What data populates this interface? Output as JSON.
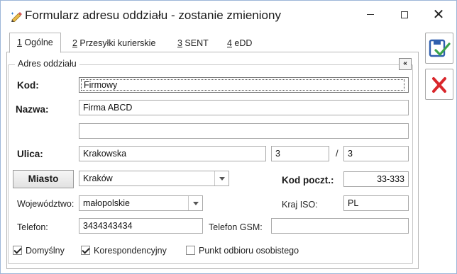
{
  "window": {
    "title": "Formularz adresu oddziału - zostanie zmieniony",
    "minimize_icon": "minimize-icon",
    "maximize_icon": "maximize-icon",
    "close_label": "✕"
  },
  "tabs": [
    {
      "key": "1",
      "label": " Ogólne",
      "active": true
    },
    {
      "key": "2",
      "label": " Przesyłki kurierskie",
      "active": false
    },
    {
      "key": "3",
      "label": " SENT",
      "active": false
    },
    {
      "key": "4",
      "label": " eDD",
      "active": false
    }
  ],
  "group": {
    "title": "Adres oddziału",
    "collapse_label": "«"
  },
  "form": {
    "kod_label": "Kod:",
    "kod_value": "Firmowy",
    "nazwa_label": "Nazwa:",
    "nazwa_value": "Firma ABCD",
    "nazwa2_value": "",
    "ulica_label": "Ulica:",
    "ulica_value": "Krakowska",
    "nr_domu": "3",
    "slash": "/",
    "nr_lokalu": "3",
    "miasto_button": "Miasto",
    "miasto_value": "Kraków",
    "kod_poczt_label": "Kod poczt.:",
    "kod_poczt_value": "33-333",
    "wojewodztwo_label": "Województwo:",
    "wojewodztwo_value": "małopolskie",
    "kraj_iso_label": "Kraj ISO:",
    "kraj_iso_value": "PL",
    "telefon_label": "Telefon:",
    "telefon_value": "3434343434",
    "telefon_gsm_label": "Telefon GSM:",
    "telefon_gsm_value": ""
  },
  "checkboxes": {
    "domyslny": {
      "label": "Domyślny",
      "checked": true
    },
    "korespondencyjny": {
      "label": "Korespondencyjny",
      "checked": true
    },
    "punkt_odbioru": {
      "label": "Punkt odbioru osobistego",
      "checked": false
    }
  },
  "actions": {
    "save_icon": "save-disk-icon",
    "cancel_icon": "cancel-x-icon"
  },
  "colors": {
    "accent_blue": "#2f5fae",
    "save_check_green": "#3aa34a",
    "cancel_red": "#d9262b"
  }
}
